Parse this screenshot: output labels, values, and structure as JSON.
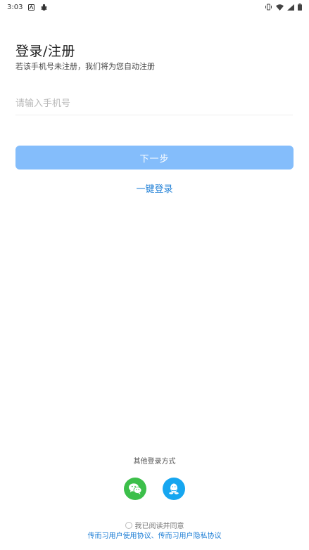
{
  "status_bar": {
    "time": "3:03"
  },
  "title": "登录/注册",
  "subtitle": "若该手机号未注册，我们将为您自动注册",
  "phone_input": {
    "placeholder": "请输入手机号",
    "value": ""
  },
  "next_button_label": "下一步",
  "one_click_login_label": "一键登录",
  "other_login_label": "其他登录方式",
  "agreement": {
    "prefix": "我已阅读并同意",
    "user_agreement": "传而习用户使用协议",
    "separator": "、",
    "privacy_agreement": "传而习用户隐私协议"
  },
  "colors": {
    "primary_button": "#84bdfb",
    "link": "#1f7fd6",
    "wechat": "#3cbf4a",
    "qq": "#16a6f0"
  }
}
